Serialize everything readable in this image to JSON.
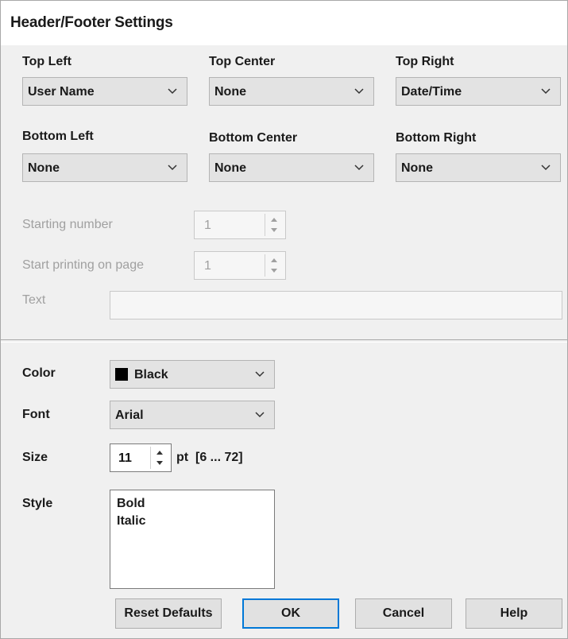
{
  "dialog": {
    "title": "Header/Footer Settings"
  },
  "positions": {
    "top_left": {
      "label": "Top Left",
      "value": "User Name"
    },
    "top_center": {
      "label": "Top Center",
      "value": "None"
    },
    "top_right": {
      "label": "Top Right",
      "value": "Date/Time"
    },
    "bottom_left": {
      "label": "Bottom Left",
      "value": "None"
    },
    "bottom_center": {
      "label": "Bottom Center",
      "value": "None"
    },
    "bottom_right": {
      "label": "Bottom Right",
      "value": "None"
    }
  },
  "numbering": {
    "starting_number": {
      "label": "Starting number",
      "value": "1",
      "enabled": false
    },
    "start_printing_on_page": {
      "label": "Start printing on page",
      "value": "1",
      "enabled": false
    },
    "text": {
      "label": "Text",
      "value": "",
      "enabled": false
    }
  },
  "format": {
    "color": {
      "label": "Color",
      "value": "Black",
      "swatch": "#000000"
    },
    "font": {
      "label": "Font",
      "value": "Arial"
    },
    "size": {
      "label": "Size",
      "value": "11",
      "unit": "pt",
      "range": "[6 ... 72]"
    },
    "style": {
      "label": "Style",
      "options": [
        "Bold",
        "Italic"
      ]
    }
  },
  "buttons": {
    "reset": "Reset Defaults",
    "ok": "OK",
    "cancel": "Cancel",
    "help": "Help"
  },
  "colors": {
    "disabled_text": "#a0a0a0",
    "default_button_border": "#0078d7"
  }
}
